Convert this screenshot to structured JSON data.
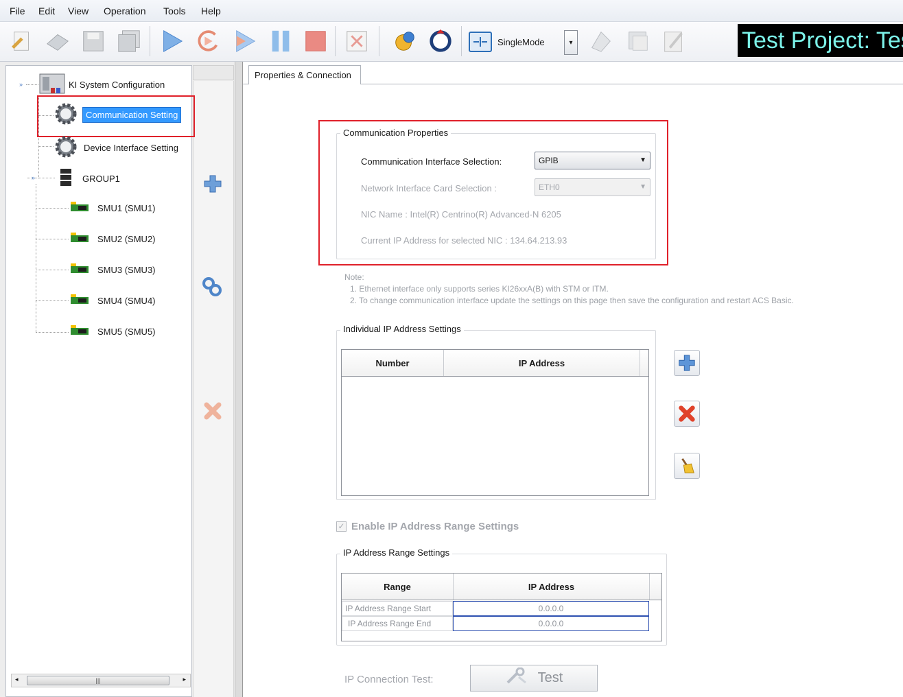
{
  "menu": [
    "File",
    "Edit",
    "View",
    "Operation",
    "Tools",
    "Help"
  ],
  "toolbar": {
    "mode_label": "SingleMode",
    "project_title": "Test Project: Tes"
  },
  "tree": {
    "root": "KI System Configuration",
    "items": [
      {
        "label": "Communication Setting",
        "icon": "gear-icon",
        "selected": true
      },
      {
        "label": "Device Interface Setting",
        "icon": "gear-icon",
        "selected": false
      }
    ],
    "group": "GROUP1",
    "smus": [
      "SMU1 (SMU1)",
      "SMU2 (SMU2)",
      "SMU3 (SMU3)",
      "SMU4 (SMU4)",
      "SMU5 (SMU5)"
    ]
  },
  "tab": {
    "label": "Properties & Connection"
  },
  "comm": {
    "title": "Communication Properties",
    "interface_label": "Communication Interface Selection:",
    "interface_value": "GPIB",
    "nic_label": "Network Interface Card Selection :",
    "nic_value": "ETH0",
    "nic_name": "NIC Name : Intel(R) Centrino(R) Advanced-N 6205",
    "current_ip": "Current IP Address for selected NIC :  134.64.213.93"
  },
  "note": {
    "heading": "Note:",
    "line1": "1. Ethernet interface only supports series KI26xxA(B) with STM or ITM.",
    "line2": "2. To change communication interface update the settings on this page then save the configuration and restart ACS Basic."
  },
  "individual": {
    "title": "Individual IP Address Settings",
    "col_number": "Number",
    "col_ip": "IP Address"
  },
  "range": {
    "enable_label": "Enable IP Address Range Settings",
    "title": "IP Address Range Settings",
    "col_range": "Range",
    "col_ip": "IP Address",
    "rows": [
      {
        "range": "IP Address Range Start",
        "ip": "0.0.0.0"
      },
      {
        "range": "IP Address Range End",
        "ip": "0.0.0.0"
      }
    ]
  },
  "test": {
    "label": "IP Connection Test:",
    "button": "Test"
  },
  "colors": {
    "selection": "#3399ff",
    "highlight_box": "#e0202a",
    "title_text": "#7cf2e9"
  }
}
